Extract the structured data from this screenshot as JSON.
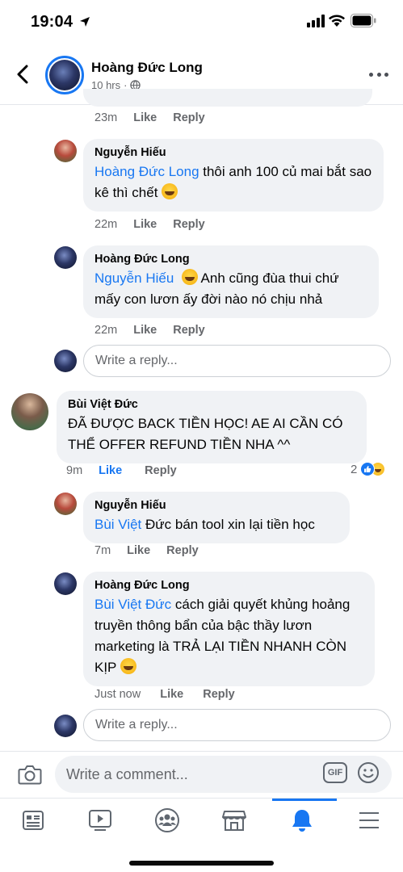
{
  "status": {
    "time": "19:04"
  },
  "header": {
    "name": "Hoàng Đức Long",
    "time": "10 hrs",
    "separator": "·"
  },
  "action_labels": {
    "like": "Like",
    "reply": "Reply"
  },
  "comments": [
    {
      "time": "23m"
    },
    {
      "author": "Nguyễn Hiếu",
      "mention": "Hoàng Đức Long",
      "text_before_emoji": " thôi anh 100 củ mai bắt sao kê thì chết ",
      "time": "22m"
    },
    {
      "author": "Hoàng Đức Long",
      "mention": "Nguyễn Hiếu",
      "text_after_emoji": " Anh cũng đùa thui chứ mấy con lươn ấy đời nào nó chịu nhả",
      "time": "22m"
    },
    {
      "author": "Bùi Việt Đức",
      "text": "ĐÃ ĐƯỢC BACK TIỀN HỌC! AE AI CẦN CÓ THỂ OFFER REFUND TIỀN NHA ^^",
      "time": "9m",
      "reaction_count": "2"
    },
    {
      "author": "Nguyễn Hiếu",
      "mention": "Bùi Việt",
      "text": " Đức bán tool xin lại tiền học",
      "time": "7m"
    },
    {
      "author": "Hoàng Đức Long",
      "mention": "Bùi Việt Đức",
      "text": "  cách giải quyết khủng hoảng truyền thông bẩn của bậc thầy lươn marketing là TRẢ LẠI TIỀN NHANH CÒN KỊP ",
      "time": "Just now"
    }
  ],
  "reply_placeholder": "Write a reply...",
  "composer": {
    "placeholder": "Write a comment...",
    "gif_label": "GIF"
  },
  "tabs": [
    "news-feed",
    "watch",
    "groups",
    "marketplace",
    "notifications",
    "menu"
  ],
  "colors": {
    "accent": "#1877f2",
    "bubble": "#f0f2f5",
    "muted": "#65676b"
  }
}
